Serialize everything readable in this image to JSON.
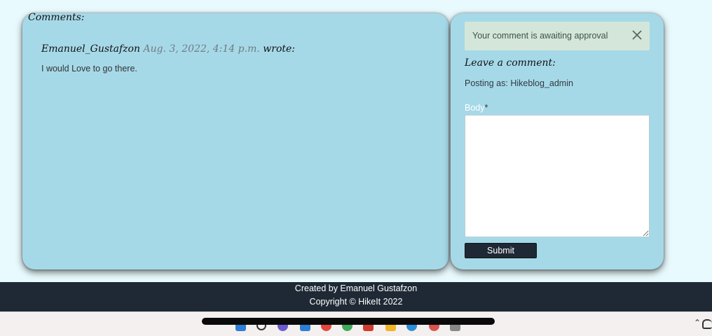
{
  "comments": {
    "heading": "Comments:",
    "items": [
      {
        "author": "Emanuel_Gustafzon",
        "date": "Aug. 3, 2022, 4:14 p.m.",
        "wrote": "wrote:",
        "body": "I would Love to go there."
      }
    ]
  },
  "form": {
    "alert": "Your comment is awaiting approval",
    "heading": "Leave a comment:",
    "posting_as": "Posting as: Hikeblog_admin",
    "body_label": "Body",
    "required_mark": "*",
    "submit_label": "Submit"
  },
  "footer": {
    "created_by": "Created by Emanuel Gustafzon",
    "copyright": "Copyright © HikeIt 2022"
  },
  "taskbar": {
    "icons": [
      "windows-start-icon",
      "search-icon",
      "chat-icon",
      "mail-icon",
      "chrome-icon",
      "browser-icon",
      "office-icon",
      "folder-icon",
      "edge-icon",
      "pin-icon",
      "cart-icon"
    ],
    "tray": [
      "chevron-up-icon",
      "onedrive-icon"
    ]
  },
  "colors": {
    "page_bg": "#e8fafd",
    "card_bg": "#a6d9e8",
    "footer_bg": "#1f2935",
    "alert_bg": "#d3e6d9"
  }
}
